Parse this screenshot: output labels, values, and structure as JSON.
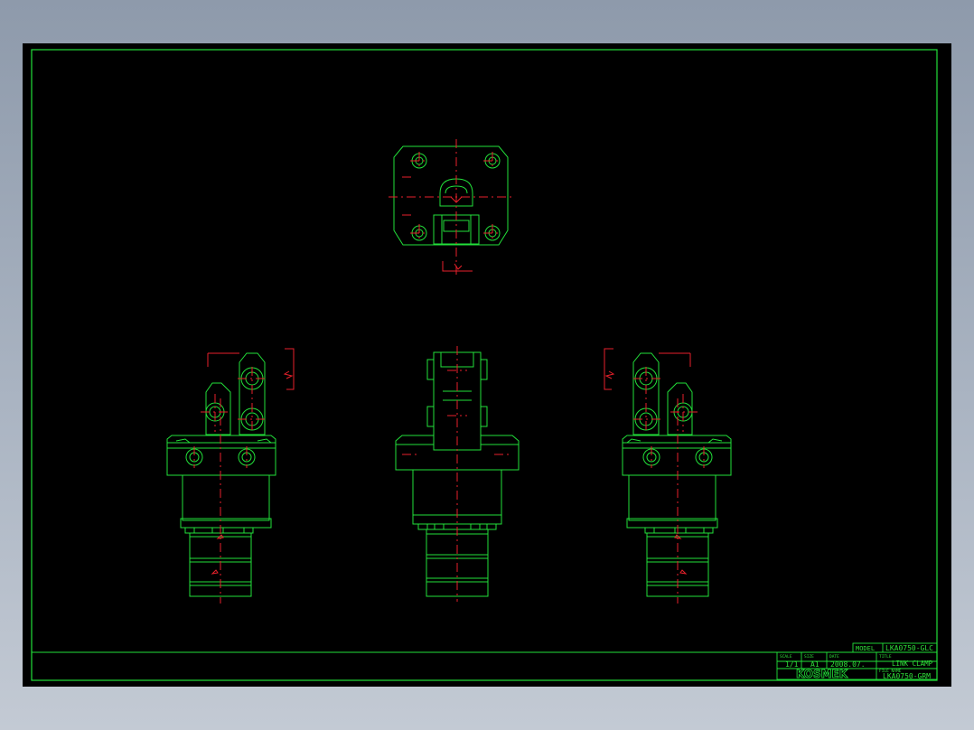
{
  "drawing": {
    "background": "#000000",
    "outline_color": "#22e03a",
    "centerline_color": "#e8212b"
  },
  "title_block": {
    "model_label": "MODEL",
    "model_value": "LKA0750-GLC",
    "scale_label": "SCALE",
    "scale_value": "1/1",
    "size_label": "SIZE",
    "size_value": "A1",
    "date_label": "DATE",
    "date_value": "2008.07.",
    "title_label": "TITLE",
    "title_value": "LINK CLAMP",
    "file_label": "FILE NAME",
    "file_value": "LKA0750-GRM",
    "brand": "KOSMEK"
  }
}
